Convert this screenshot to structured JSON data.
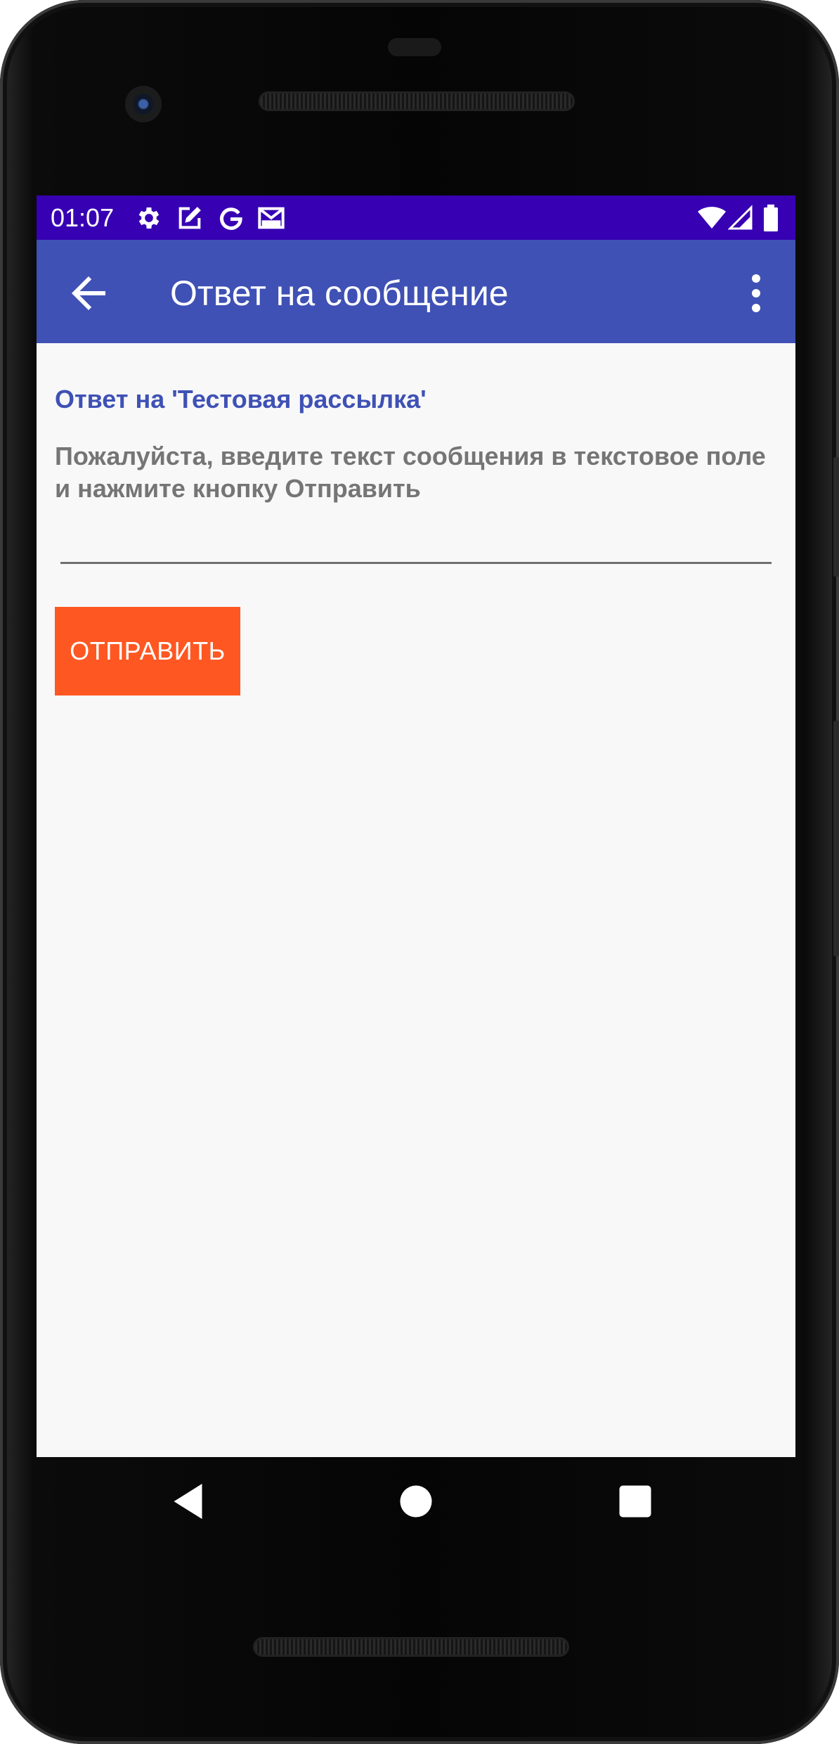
{
  "statusbar": {
    "time": "01:07",
    "left_icons": [
      "gear-icon",
      "edit-square-icon",
      "google-g-icon",
      "gmail-icon"
    ],
    "right_icons": [
      "wifi-icon",
      "cell-signal-icon",
      "battery-icon"
    ],
    "background": "#3700b3"
  },
  "appbar": {
    "title": "Ответ на сообщение",
    "background": "#3f51b5"
  },
  "content": {
    "reply_title": "Ответ на 'Тестовая рассылка'",
    "instructions": "Пожалуйста, введите текст сообщения в текстовое поле и нажмите кнопку Отправить",
    "message_input": {
      "value": "",
      "placeholder": ""
    },
    "send_label": "ОТПРАВИТЬ",
    "send_color": "#ff5722",
    "accent_color": "#3f51b5"
  },
  "navbar": {
    "buttons": [
      "back-triangle-icon",
      "home-circle-icon",
      "recents-square-icon"
    ]
  }
}
